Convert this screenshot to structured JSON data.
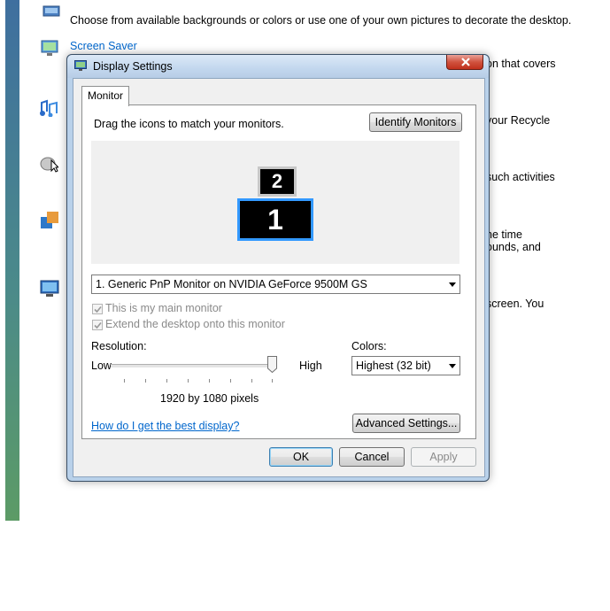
{
  "background": {
    "desc_background": "Choose from available backgrounds or colors or use one of your own pictures to decorate the desktop.",
    "screensaver_link": "Screen Saver",
    "frag_covers": "on that covers",
    "frag_recycle": "your Recycle",
    "frag_activities": "such activities",
    "frag_time": "ne time",
    "frag_sounds": "ounds, and",
    "frag_screen": "screen. You",
    "icons": [
      "desktop-background-icon",
      "screen-saver-icon",
      "sounds-icon",
      "mouse-pointers-icon",
      "theme-icon",
      "display-settings-icon"
    ]
  },
  "dialog": {
    "title": "Display Settings",
    "tab_monitor": "Monitor",
    "instructions": "Drag the icons to match your monitors.",
    "identify_button": "Identify Monitors",
    "monitor_1": "1",
    "monitor_2": "2",
    "monitor_select": "1. Generic PnP Monitor on NVIDIA GeForce 9500M GS",
    "main_monitor_label": "This is my main monitor",
    "main_monitor_checked": true,
    "extend_label": "Extend the desktop onto this monitor",
    "extend_checked": true,
    "resolution_label": "Resolution:",
    "low_label": "Low",
    "high_label": "High",
    "resolution_slider_fraction": 1.0,
    "resolution_value": "1920 by 1080 pixels",
    "colors_label": "Colors:",
    "colors_select": "Highest (32 bit)",
    "help_link": "How do I get the best display?",
    "advanced_button": "Advanced Settings...",
    "ok_button": "OK",
    "cancel_button": "Cancel",
    "apply_button": "Apply"
  },
  "colors": {
    "link": "#0066cc",
    "selected_monitor_border": "#3399ff",
    "close_button": "#c0301c"
  }
}
